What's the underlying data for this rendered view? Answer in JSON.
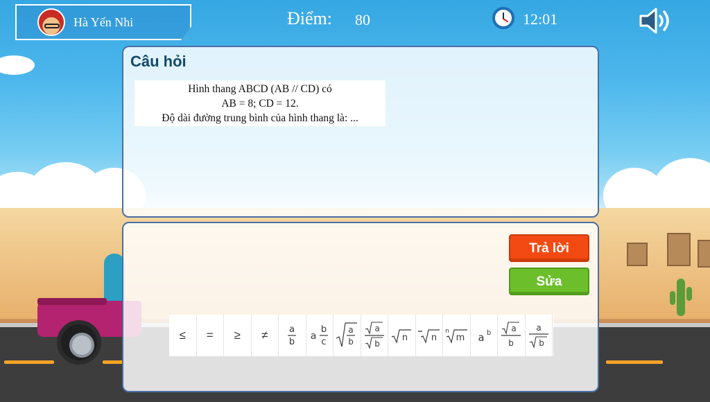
{
  "header": {
    "user_name": "Hà Yến Nhi",
    "score_label": "Điểm:",
    "score_value": "80",
    "timer": "12:01"
  },
  "question": {
    "heading": "Câu hỏi",
    "lines": [
      "Hình thang ABCD (AB // CD) có",
      "AB = 8; CD = 12.",
      "Độ dài đường trung bình của hình thang là:  ..."
    ]
  },
  "answer": {
    "submit_label": "Trả lời",
    "edit_label": "Sửa"
  },
  "toolbar": {
    "symbols": [
      {
        "name": "less-equal",
        "label": "≤"
      },
      {
        "name": "equals",
        "label": "="
      },
      {
        "name": "greater-equal",
        "label": "≥"
      },
      {
        "name": "not-equal",
        "label": "≠"
      },
      {
        "name": "fraction",
        "label": "a/b"
      },
      {
        "name": "mixed-number",
        "label": "a b/c"
      },
      {
        "name": "sqrt-fraction",
        "label": "√(a/b)"
      },
      {
        "name": "fraction-of-roots",
        "label": "√a/√b"
      },
      {
        "name": "square-root",
        "label": "√n"
      },
      {
        "name": "negative-root",
        "label": "-√n"
      },
      {
        "name": "nth-root",
        "label": "n√m"
      },
      {
        "name": "power",
        "label": "aᵇ"
      },
      {
        "name": "root-over-number",
        "label": "√a/b"
      },
      {
        "name": "number-over-root",
        "label": "a/√b"
      }
    ]
  }
}
